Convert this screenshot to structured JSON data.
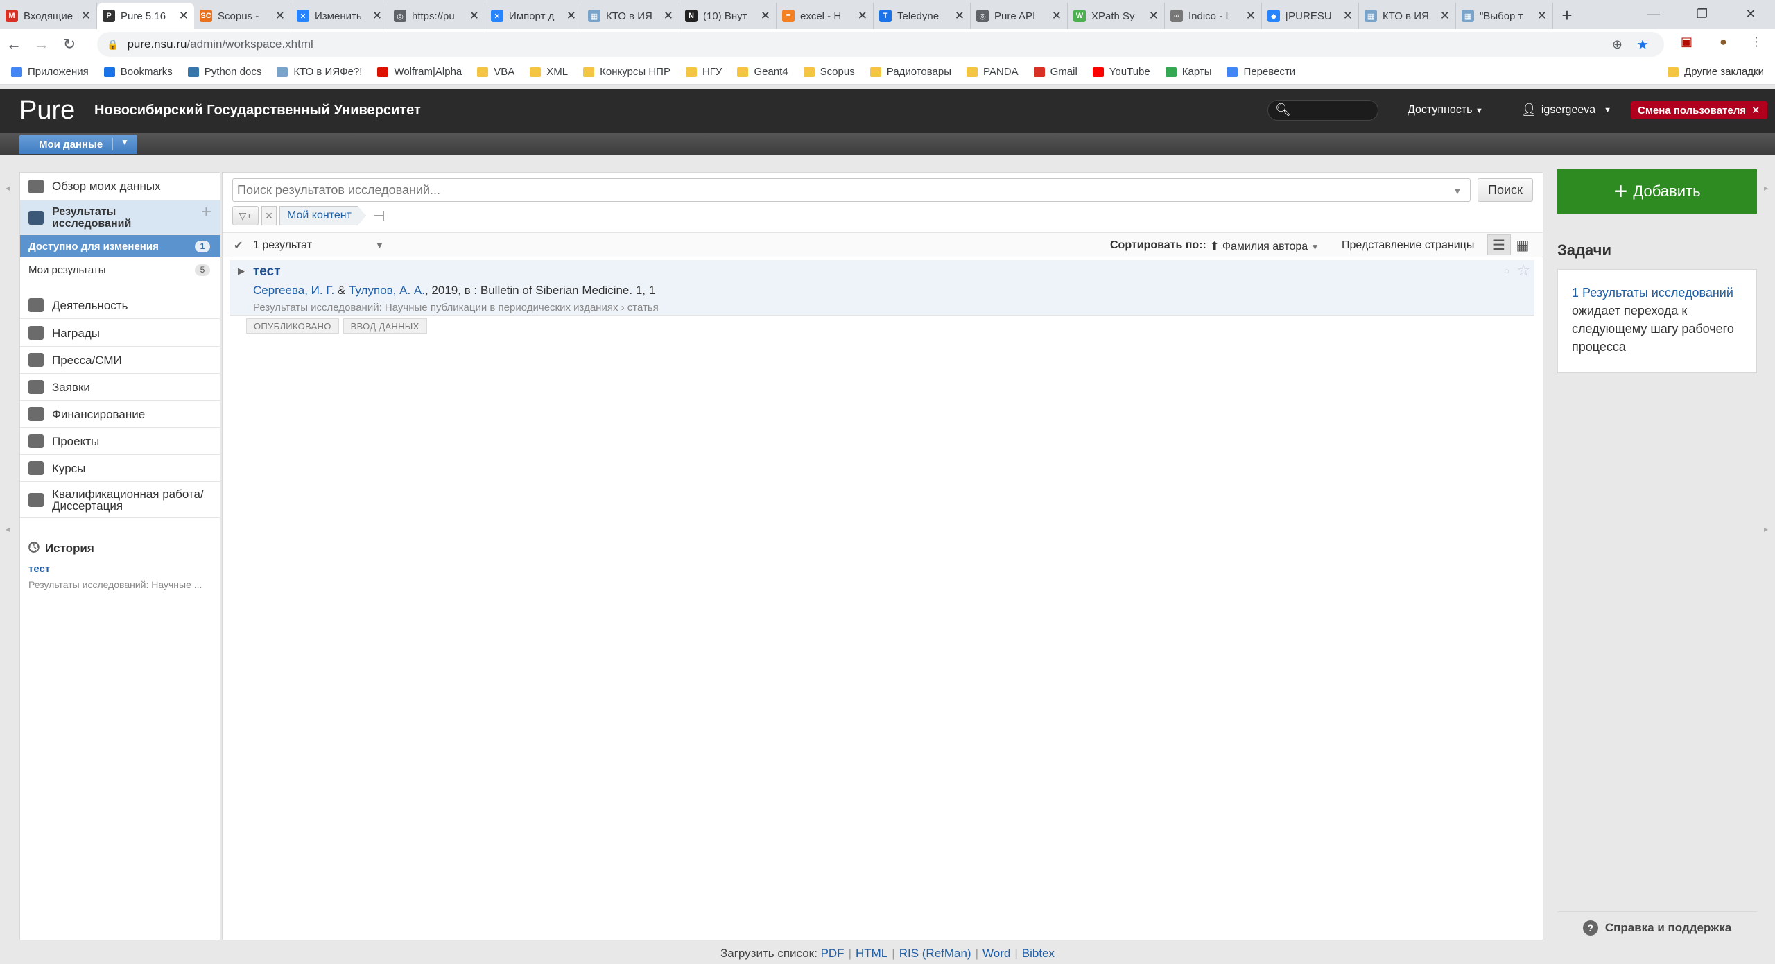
{
  "browser": {
    "tabs": [
      {
        "label": "Входящие",
        "icon": "gmail-icon",
        "color": "#d93025",
        "glyph": "M"
      },
      {
        "label": "Pure 5.16",
        "icon": "pure-icon",
        "color": "#333333",
        "glyph": "P",
        "active": true
      },
      {
        "label": "Scopus - ",
        "icon": "scopus-icon",
        "color": "#e9711c",
        "glyph": "SC"
      },
      {
        "label": "Изменить",
        "icon": "confluence-icon",
        "color": "#2684ff",
        "glyph": "✕"
      },
      {
        "label": "https://pu",
        "icon": "globe-icon",
        "color": "#5f6368",
        "glyph": "◎"
      },
      {
        "label": "Импорт д",
        "icon": "confluence-icon",
        "color": "#2684ff",
        "glyph": "✕"
      },
      {
        "label": "КТО в ИЯ",
        "icon": "map-icon",
        "color": "#7aa3c9",
        "glyph": "▦"
      },
      {
        "label": "(10) Внут",
        "icon": "notion-icon",
        "color": "#222222",
        "glyph": "N"
      },
      {
        "label": "excel - Н",
        "icon": "stack-icon",
        "color": "#f48024",
        "glyph": "≡"
      },
      {
        "label": "Teledyne",
        "icon": "teledyne-icon",
        "color": "#1a73e8",
        "glyph": "T"
      },
      {
        "label": "Pure API",
        "icon": "globe-icon",
        "color": "#5f6368",
        "glyph": "◎"
      },
      {
        "label": "XPath Sy",
        "icon": "w3-icon",
        "color": "#4caf50",
        "glyph": "W"
      },
      {
        "label": "Indico - I",
        "icon": "indico-icon",
        "color": "#777777",
        "glyph": "∞"
      },
      {
        "label": "[PURESU",
        "icon": "jira-icon",
        "color": "#2684ff",
        "glyph": "◆"
      },
      {
        "label": "КТО в ИЯ",
        "icon": "map-icon",
        "color": "#7aa3c9",
        "glyph": "▦"
      },
      {
        "label": "\"Выбор т",
        "icon": "map-icon",
        "color": "#7aa3c9",
        "glyph": "▦"
      }
    ],
    "url_host": "pure.nsu.ru",
    "url_path": "/admin/workspace.xhtml",
    "bookmarks": [
      {
        "label": "Приложения",
        "icon": "apps-icon"
      },
      {
        "label": "Bookmarks",
        "icon": "star-icon"
      },
      {
        "label": "Python docs",
        "icon": "python-icon"
      },
      {
        "label": "КТО в ИЯФе?!",
        "icon": "map-icon"
      },
      {
        "label": "Wolfram|Alpha",
        "icon": "wolfram-icon"
      },
      {
        "label": "VBA",
        "icon": "folder-icon"
      },
      {
        "label": "XML",
        "icon": "folder-icon"
      },
      {
        "label": "Конкурсы НПР",
        "icon": "folder-icon"
      },
      {
        "label": "НГУ",
        "icon": "folder-icon"
      },
      {
        "label": "Geant4",
        "icon": "folder-icon"
      },
      {
        "label": "Scopus",
        "icon": "folder-icon"
      },
      {
        "label": "Радиотовары",
        "icon": "folder-icon"
      },
      {
        "label": "PANDA",
        "icon": "folder-icon"
      },
      {
        "label": "Gmail",
        "icon": "gmail-icon"
      },
      {
        "label": "YouTube",
        "icon": "youtube-icon"
      },
      {
        "label": "Карты",
        "icon": "maps-icon"
      },
      {
        "label": "Перевести",
        "icon": "translate-icon"
      }
    ],
    "other_bookmarks": "Другие закладки"
  },
  "header": {
    "logo": "Pure",
    "university": "Новосибирский Государственный Университет",
    "accessibility": "Доступность",
    "username": "igsergeeva",
    "switch_user": "Смена пользователя",
    "my_data": "Мои данные"
  },
  "sidebar": {
    "overview": "Обзор моих данных",
    "results": "Результаты исследований",
    "editable": {
      "label": "Доступно для изменения",
      "count": "1"
    },
    "my_results": {
      "label": "Мои результаты",
      "count": "5"
    },
    "items": [
      {
        "label": "Деятельность",
        "icon": "briefcase-icon"
      },
      {
        "label": "Награды",
        "icon": "trophy-icon"
      },
      {
        "label": "Пресса/СМИ",
        "icon": "newspaper-icon"
      },
      {
        "label": "Заявки",
        "icon": "applications-icon"
      },
      {
        "label": "Финансирование",
        "icon": "money-bag-icon"
      },
      {
        "label": "Проекты",
        "icon": "cube-icon"
      },
      {
        "label": "Курсы",
        "icon": "courses-icon"
      },
      {
        "label": "Квалификационная работа/ Диссертация",
        "icon": "graduation-cap-icon"
      }
    ],
    "history": {
      "title": "История",
      "link": "тест",
      "sub": "Результаты исследований: Научные ..."
    }
  },
  "main": {
    "search_placeholder": "Поиск результатов исследований...",
    "search_button": "Поиск",
    "filter_chip": "Мой контент",
    "result_count": "1 результат",
    "sort_label": "Сортировать по::",
    "sort_value": "Фамилия автора",
    "page_view": "Представление страницы",
    "result": {
      "title": "тест",
      "author1": "Сергеева, И. Г.",
      "amp": "&",
      "author2": "Тулупов, А. А.",
      "rest": ", 2019, в : Bulletin of Siberian Medicine. 1, 1",
      "type": "Результаты исследований: Научные публикации в периодических изданиях › статья",
      "tags": [
        "ОПУБЛИКОВАНО",
        "ВВОД ДАННЫХ"
      ]
    }
  },
  "right": {
    "add_button": "Добавить",
    "tasks_title": "Задачи",
    "task_link": "1 Результаты исследований",
    "task_text": " ожидает перехода к следующему шагу рабочего процесса",
    "help": "Справка и поддержка"
  },
  "footer": {
    "label": "Загрузить список:",
    "links": [
      "PDF",
      "HTML",
      "RIS (RefMan)",
      "Word",
      "Bibtex"
    ]
  }
}
